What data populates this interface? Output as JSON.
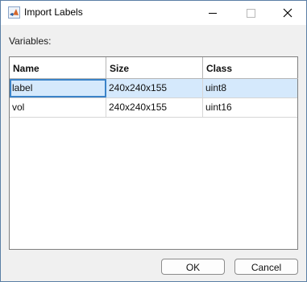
{
  "window": {
    "title": "Import Labels"
  },
  "variables_label": "Variables:",
  "table": {
    "columns": [
      "Name",
      "Size",
      "Class"
    ],
    "rows": [
      {
        "name": "label",
        "size": "240x240x155",
        "class": "uint8"
      },
      {
        "name": "vol",
        "size": "240x240x155",
        "class": "uint16"
      }
    ]
  },
  "buttons": {
    "ok": "OK",
    "cancel": "Cancel"
  },
  "icons": {
    "app": "matlab-app-icon",
    "minimize": "minimize-icon",
    "maximize": "maximize-icon",
    "close": "close-icon"
  }
}
